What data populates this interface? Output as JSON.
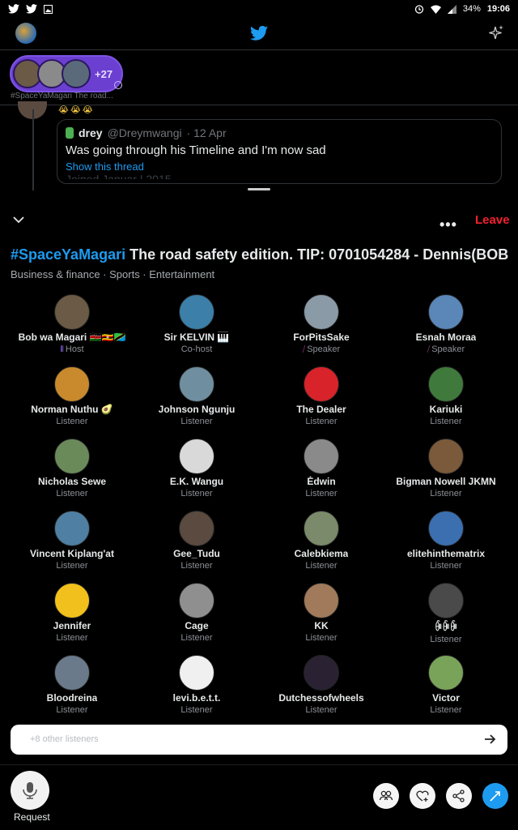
{
  "status_bar": {
    "battery": "34%",
    "time": "19:06"
  },
  "feed": {
    "pill_count": "+27",
    "pill_caption": "#SpaceYaMagari The road...",
    "quote": {
      "name": "drey",
      "handle": "@Dreymwangi",
      "date": "· 12 Apr",
      "text": "Was going through his Timeline and I'm now sad",
      "link": "Show this thread",
      "ghost": "Joined Januar | 2015"
    }
  },
  "space": {
    "leave_label": "Leave",
    "title_tag": "#SpaceYaMagari",
    "title_rest": " The road safety edition.   TIP: 0701054284 - Dennis(BOB",
    "topics": "Business & finance · Sports · Entertainment",
    "participants": [
      {
        "name": "Bob wa Magari 🇰🇪🇺🇬🇹🇿",
        "role": "Host",
        "icon": "host",
        "color": "#6b5a45"
      },
      {
        "name": "Sir KELVIN 🎹",
        "role": "Co-host",
        "icon": "",
        "color": "#3c7fa8"
      },
      {
        "name": "ForPitsSake",
        "role": "Speaker",
        "icon": "speaker",
        "color": "#8a9aa6"
      },
      {
        "name": "Esnah Moraa",
        "role": "Speaker",
        "icon": "speaker",
        "color": "#5b86b8"
      },
      {
        "name": "Norman Nuthu 🥑",
        "role": "Listener",
        "icon": "",
        "color": "#c88a2c"
      },
      {
        "name": "Johnson Ngunju",
        "role": "Listener",
        "icon": "",
        "color": "#6f8fa0"
      },
      {
        "name": "The Dealer",
        "role": "Listener",
        "icon": "",
        "color": "#d8232a"
      },
      {
        "name": "Kariuki",
        "role": "Listener",
        "icon": "",
        "color": "#3f7a3c"
      },
      {
        "name": "Nicholas Sewe",
        "role": "Listener",
        "icon": "",
        "color": "#6a8a5a"
      },
      {
        "name": "E.K. Wangu",
        "role": "Listener",
        "icon": "",
        "color": "#d9d9d9"
      },
      {
        "name": "Ėdwin",
        "role": "Listener",
        "icon": "",
        "color": "#8a8a8a"
      },
      {
        "name": "Bigman Nowell JKMN",
        "role": "Listener",
        "icon": "",
        "color": "#7a5a3a"
      },
      {
        "name": "Vincent Kiplang'at",
        "role": "Listener",
        "icon": "",
        "color": "#4f7fa2"
      },
      {
        "name": "Gee_Tudu",
        "role": "Listener",
        "icon": "",
        "color": "#5a4a40"
      },
      {
        "name": "Calebkiema",
        "role": "Listener",
        "icon": "",
        "color": "#7a8a6a"
      },
      {
        "name": "elitehinthematrix",
        "role": "Listener",
        "icon": "",
        "color": "#3b6fb0"
      },
      {
        "name": "Jennifer",
        "role": "Listener",
        "icon": "",
        "color": "#f2c01c"
      },
      {
        "name": "Cage",
        "role": "Listener",
        "icon": "",
        "color": "#8f8f8f"
      },
      {
        "name": "KK",
        "role": "Listener",
        "icon": "",
        "color": "#a07a5a"
      },
      {
        "name": "ꀼꀼꀼ",
        "role": "Listener",
        "icon": "",
        "color": "#4a4a4a"
      },
      {
        "name": "Bloodreina",
        "role": "Listener",
        "icon": "",
        "color": "#6a7a8a"
      },
      {
        "name": "levi.b.e.t.t.",
        "role": "Listener",
        "icon": "",
        "color": "#f0f0f0"
      },
      {
        "name": "Dutchessofwheels",
        "role": "Listener",
        "icon": "",
        "color": "#2a2233"
      },
      {
        "name": "Victor",
        "role": "Listener",
        "icon": "",
        "color": "#7aa35a"
      }
    ],
    "others_label": "+8 other listeners",
    "request_label": "Request"
  },
  "colors": {
    "accent": "#1d9bf0",
    "leave": "#f4212e",
    "host_purple": "#9b74ff",
    "speaker_pink": "#c13fa6"
  }
}
